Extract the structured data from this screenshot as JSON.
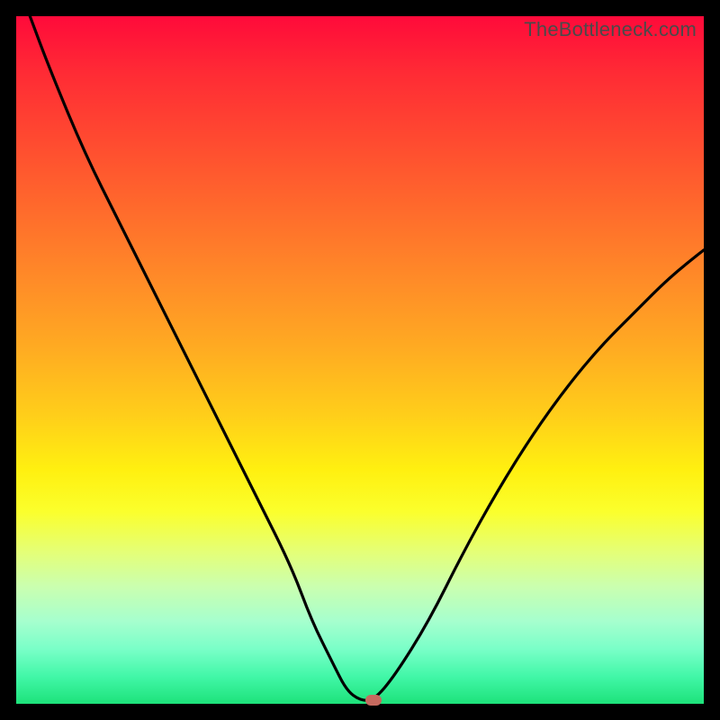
{
  "watermark": "TheBottleneck.com",
  "colors": {
    "curve": "#000000",
    "marker": "#c66a5f",
    "frame": "#000000"
  },
  "chart_data": {
    "type": "line",
    "title": "",
    "xlabel": "",
    "ylabel": "",
    "xlim": [
      0,
      100
    ],
    "ylim": [
      0,
      100
    ],
    "grid": false,
    "legend": false,
    "x_is_component_strength": true,
    "y_is_bottleneck_percent": true,
    "series": [
      {
        "name": "bottleneck-curve",
        "x": [
          2,
          5,
          10,
          15,
          20,
          25,
          30,
          35,
          40,
          43,
          46,
          48,
          50,
          52,
          55,
          60,
          65,
          70,
          75,
          80,
          85,
          90,
          95,
          100
        ],
        "y": [
          100,
          92,
          80,
          70,
          60,
          50,
          40,
          30,
          20,
          12,
          6,
          2,
          0.5,
          0.5,
          4,
          12,
          22,
          31,
          39,
          46,
          52,
          57,
          62,
          66
        ]
      }
    ],
    "flat_segment": {
      "x_start": 47,
      "x_end": 52,
      "y": 0.5
    },
    "marker": {
      "x": 52,
      "y": 0.5
    },
    "background_gradient": {
      "direction": "vertical",
      "stops": [
        {
          "pos": 0,
          "color": "#ff0a3a"
        },
        {
          "pos": 50,
          "color": "#ffb020"
        },
        {
          "pos": 72,
          "color": "#fbff2c"
        },
        {
          "pos": 100,
          "color": "#1de27a"
        }
      ]
    }
  }
}
